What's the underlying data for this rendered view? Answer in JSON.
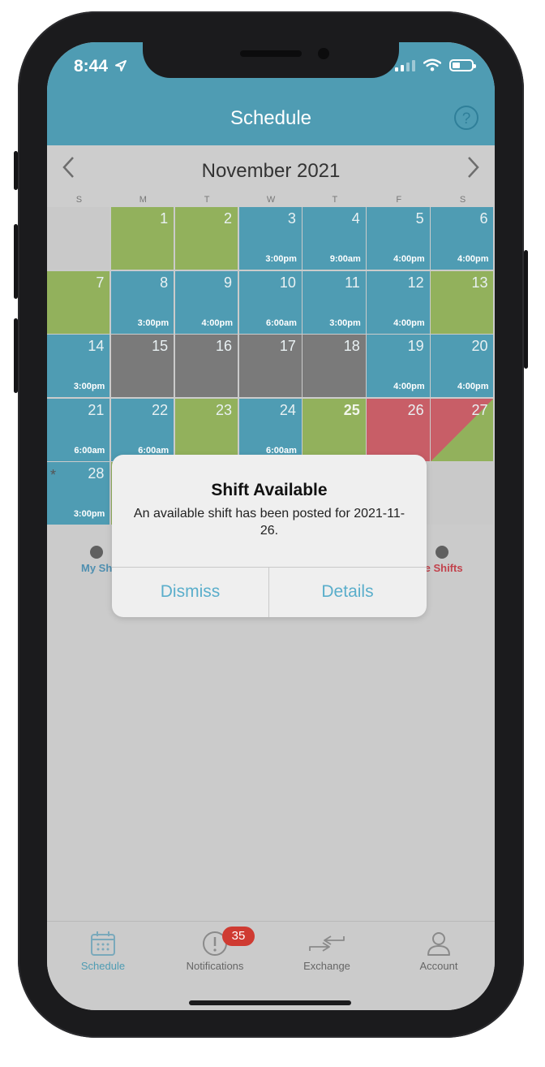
{
  "status_bar": {
    "time": "8:44",
    "location_icon": "location-arrow-icon"
  },
  "header": {
    "title": "Schedule",
    "help_label": "?"
  },
  "calendar": {
    "month": "November 2021",
    "prev_icon": "chevron-left-icon",
    "next_icon": "chevron-right-icon",
    "weekdays": [
      "S",
      "M",
      "T",
      "W",
      "T",
      "F",
      "S"
    ],
    "colors": {
      "scheduled": "#4f9cb3",
      "off": "#92b15c",
      "unavailable": "#7a7a7a",
      "available_shift": "#c85e67",
      "empty": "#c9c9c9"
    },
    "weeks": [
      [
        {
          "day": "",
          "status": "empty",
          "time": ""
        },
        {
          "day": "1",
          "status": "off",
          "time": ""
        },
        {
          "day": "2",
          "status": "off",
          "time": ""
        },
        {
          "day": "3",
          "status": "scheduled",
          "time": "3:00pm"
        },
        {
          "day": "4",
          "status": "scheduled",
          "time": "9:00am"
        },
        {
          "day": "5",
          "status": "scheduled",
          "time": "4:00pm"
        },
        {
          "day": "6",
          "status": "scheduled",
          "time": "4:00pm"
        }
      ],
      [
        {
          "day": "7",
          "status": "off",
          "time": ""
        },
        {
          "day": "8",
          "status": "scheduled",
          "time": "3:00pm"
        },
        {
          "day": "9",
          "status": "scheduled",
          "time": "4:00pm"
        },
        {
          "day": "10",
          "status": "scheduled",
          "time": "6:00am"
        },
        {
          "day": "11",
          "status": "scheduled",
          "time": "3:00pm"
        },
        {
          "day": "12",
          "status": "scheduled",
          "time": "4:00pm"
        },
        {
          "day": "13",
          "status": "off",
          "time": ""
        }
      ],
      [
        {
          "day": "14",
          "status": "scheduled",
          "time": "3:00pm"
        },
        {
          "day": "15",
          "status": "unavailable",
          "time": ""
        },
        {
          "day": "16",
          "status": "unavailable",
          "time": ""
        },
        {
          "day": "17",
          "status": "unavailable",
          "time": ""
        },
        {
          "day": "18",
          "status": "unavailable",
          "time": ""
        },
        {
          "day": "19",
          "status": "scheduled",
          "time": "4:00pm"
        },
        {
          "day": "20",
          "status": "scheduled",
          "time": "4:00pm"
        }
      ],
      [
        {
          "day": "21",
          "status": "scheduled",
          "time": "6:00am"
        },
        {
          "day": "22",
          "status": "scheduled",
          "time": "6:00am"
        },
        {
          "day": "23",
          "status": "off",
          "time": ""
        },
        {
          "day": "24",
          "status": "scheduled",
          "time": "6:00am"
        },
        {
          "day": "25",
          "status": "off",
          "time": "",
          "today": true
        },
        {
          "day": "26",
          "status": "available_shift",
          "time": ""
        },
        {
          "day": "27",
          "status": "split",
          "time": ""
        }
      ],
      [
        {
          "day": "28",
          "status": "scheduled",
          "time": "3:00pm",
          "marker": "*"
        },
        {
          "day": "",
          "status": "off",
          "time": ""
        },
        {
          "day": "",
          "status": "empty",
          "time": ""
        },
        {
          "day": "",
          "status": "empty",
          "time": ""
        },
        {
          "day": "",
          "status": "empty",
          "time": ""
        },
        {
          "day": "",
          "status": "empty",
          "time": ""
        },
        {
          "day": "",
          "status": "empty",
          "time": ""
        }
      ]
    ]
  },
  "legend": {
    "left_label": "My Sh",
    "right_label": "le Shifts"
  },
  "modal": {
    "title": "Shift Available",
    "message": "An available shift has been posted for 2021-11-26.",
    "dismiss_label": "Dismiss",
    "details_label": "Details"
  },
  "tabbar": {
    "tabs": [
      {
        "label": "Schedule",
        "icon": "calendar-icon",
        "active": true
      },
      {
        "label": "Notifications",
        "icon": "alert-circle-icon",
        "badge": "35"
      },
      {
        "label": "Exchange",
        "icon": "exchange-arrows-icon"
      },
      {
        "label": "Account",
        "icon": "user-icon"
      }
    ],
    "active_color": "#4f9cb3"
  }
}
